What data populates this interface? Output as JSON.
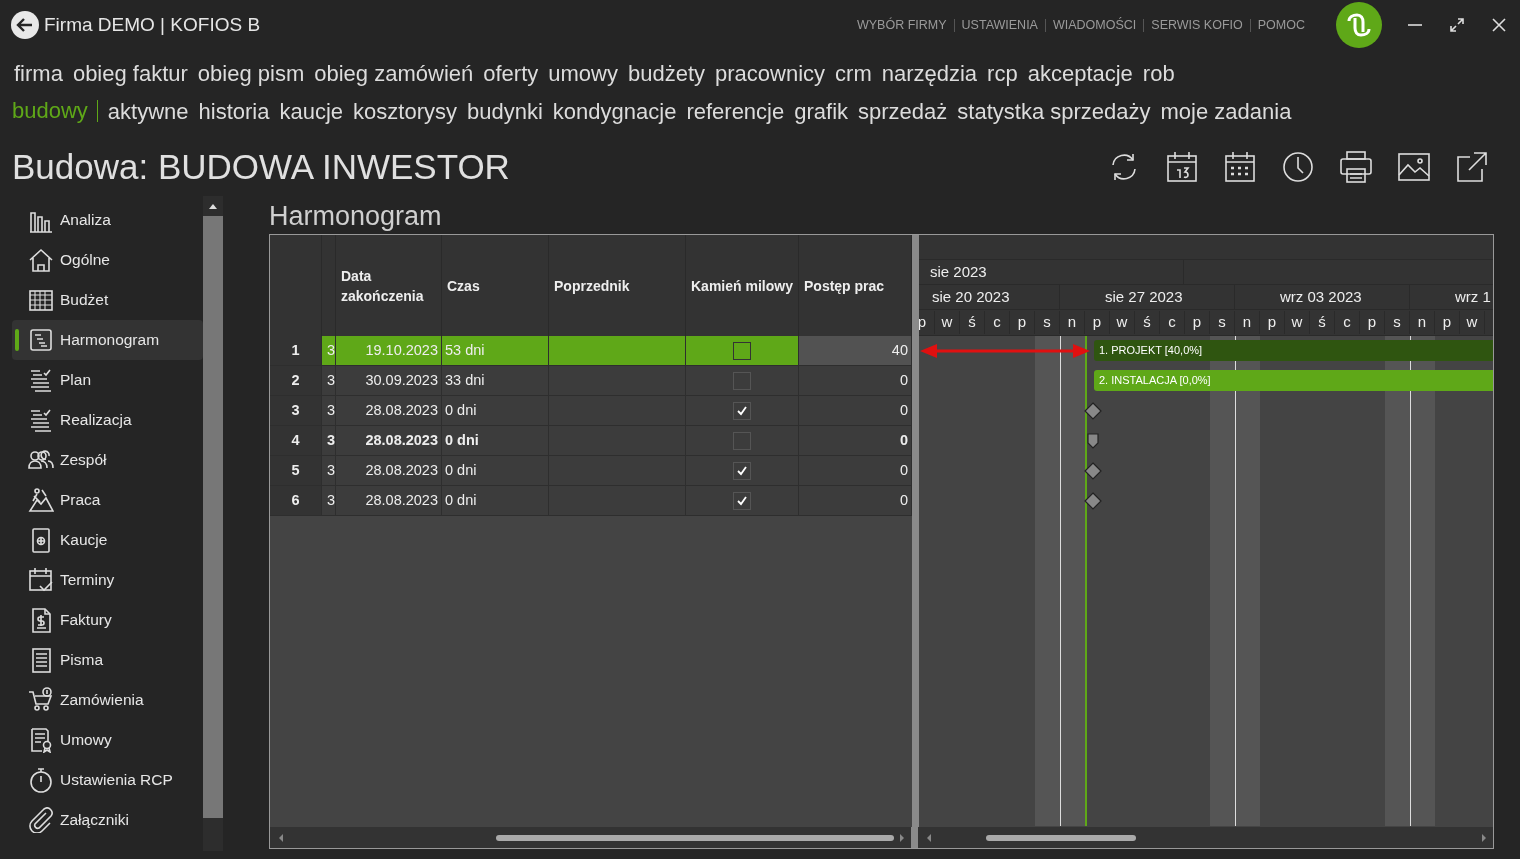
{
  "window": {
    "title": "Firma DEMO | KOFIOS B",
    "links": [
      "WYBÓR FIRMY",
      "USTAWIENIA",
      "WIADOMOŚCI",
      "SERWIS KOFIO",
      "POMOC"
    ]
  },
  "main_menu": [
    "firma",
    "obieg faktur",
    "obieg pism",
    "obieg zamówień",
    "oferty",
    "umowy",
    "budżety",
    "pracownicy",
    "crm",
    "narzędzia",
    "rcp",
    "akceptacje",
    "rob"
  ],
  "sub_menu": {
    "section": "budowy",
    "items": [
      "aktywne",
      "historia",
      "kaucje",
      "kosztorysy",
      "budynki",
      "kondygnacje",
      "referencje",
      "grafik",
      "sprzedaż",
      "statystka sprzedaży",
      "moje zadania"
    ]
  },
  "page_title": "Budowa: BUDOWA INWESTOR",
  "sidebar": {
    "items": [
      {
        "label": "Analiza",
        "selected": false
      },
      {
        "label": "Ogólne",
        "selected": false
      },
      {
        "label": "Budżet",
        "selected": false
      },
      {
        "label": "Harmonogram",
        "selected": true
      },
      {
        "label": "Plan",
        "selected": false
      },
      {
        "label": "Realizacja",
        "selected": false
      },
      {
        "label": "Zespół",
        "selected": false
      },
      {
        "label": "Praca",
        "selected": false
      },
      {
        "label": "Kaucje",
        "selected": false
      },
      {
        "label": "Terminy",
        "selected": false
      },
      {
        "label": "Faktury",
        "selected": false
      },
      {
        "label": "Pisma",
        "selected": false
      },
      {
        "label": "Zamówienia",
        "selected": false
      },
      {
        "label": "Umowy",
        "selected": false
      },
      {
        "label": "Ustawienia RCP",
        "selected": false
      },
      {
        "label": "Załączniki",
        "selected": false
      }
    ]
  },
  "section_title": "Harmonogram",
  "table": {
    "columns": [
      "Data zakończenia",
      "Czas",
      "Poprzednik",
      "Kamień milowy",
      "Postęp prac"
    ],
    "rows": [
      {
        "number": "1",
        "column_2": "3",
        "end_date": "19.10.2023",
        "duration": "53 dni",
        "milestone": false,
        "progress": "40",
        "bold": false,
        "selected": true
      },
      {
        "number": "2",
        "column_2": "3",
        "end_date": "30.09.2023",
        "duration": "33 dni",
        "milestone": false,
        "progress": "0",
        "bold": false,
        "selected": false
      },
      {
        "number": "3",
        "column_2": "3",
        "end_date": "28.08.2023",
        "duration": "0 dni",
        "milestone": true,
        "progress": "0",
        "bold": false,
        "selected": false
      },
      {
        "number": "4",
        "column_2": "3",
        "end_date": "28.08.2023",
        "duration": "0 dni",
        "milestone": false,
        "progress": "0",
        "bold": true,
        "selected": false
      },
      {
        "number": "5",
        "column_2": "3",
        "end_date": "28.08.2023",
        "duration": "0 dni",
        "milestone": true,
        "progress": "0",
        "bold": false,
        "selected": false
      },
      {
        "number": "6",
        "column_2": "3",
        "end_date": "28.08.2023",
        "duration": "0 dni",
        "milestone": true,
        "progress": "0",
        "bold": false,
        "selected": false
      }
    ]
  },
  "gantt": {
    "month": "sie 2023",
    "weeks": [
      "sie 20 2023",
      "sie 27 2023",
      "wrz 03 2023",
      "wrz 1"
    ],
    "days": [
      {
        "label": "p",
        "weekend": false,
        "today": false
      },
      {
        "label": "w",
        "weekend": false,
        "today": false
      },
      {
        "label": "ś",
        "weekend": false,
        "today": false
      },
      {
        "label": "c",
        "weekend": false,
        "today": false
      },
      {
        "label": "p",
        "weekend": false,
        "today": false
      },
      {
        "label": "s",
        "weekend": true,
        "today": false
      },
      {
        "label": "n",
        "weekend": true,
        "today": false
      },
      {
        "label": "p",
        "weekend": false,
        "today": true
      },
      {
        "label": "w",
        "weekend": false,
        "today": false
      },
      {
        "label": "ś",
        "weekend": false,
        "today": false
      },
      {
        "label": "c",
        "weekend": false,
        "today": false
      },
      {
        "label": "p",
        "weekend": false,
        "today": false
      },
      {
        "label": "s",
        "weekend": true,
        "today": false
      },
      {
        "label": "n",
        "weekend": true,
        "today": false
      },
      {
        "label": "p",
        "weekend": false,
        "today": false
      },
      {
        "label": "w",
        "weekend": false,
        "today": false
      },
      {
        "label": "ś",
        "weekend": false,
        "today": false
      },
      {
        "label": "c",
        "weekend": false,
        "today": false
      },
      {
        "label": "p",
        "weekend": false,
        "today": false
      },
      {
        "label": "s",
        "weekend": true,
        "today": false
      },
      {
        "label": "n",
        "weekend": true,
        "today": false
      },
      {
        "label": "p",
        "weekend": false,
        "today": false
      },
      {
        "label": "w",
        "weekend": false,
        "today": false
      }
    ],
    "tasks": [
      {
        "kind": "bar",
        "label": "1. PROJEKT [40,0%]",
        "color": "#2f5510"
      },
      {
        "kind": "bar",
        "label": "2. INSTALACJA [0,0%]",
        "color": "#5fa818"
      },
      {
        "kind": "milestone"
      },
      {
        "kind": "summary-milestone"
      },
      {
        "kind": "milestone"
      },
      {
        "kind": "milestone"
      }
    ]
  }
}
